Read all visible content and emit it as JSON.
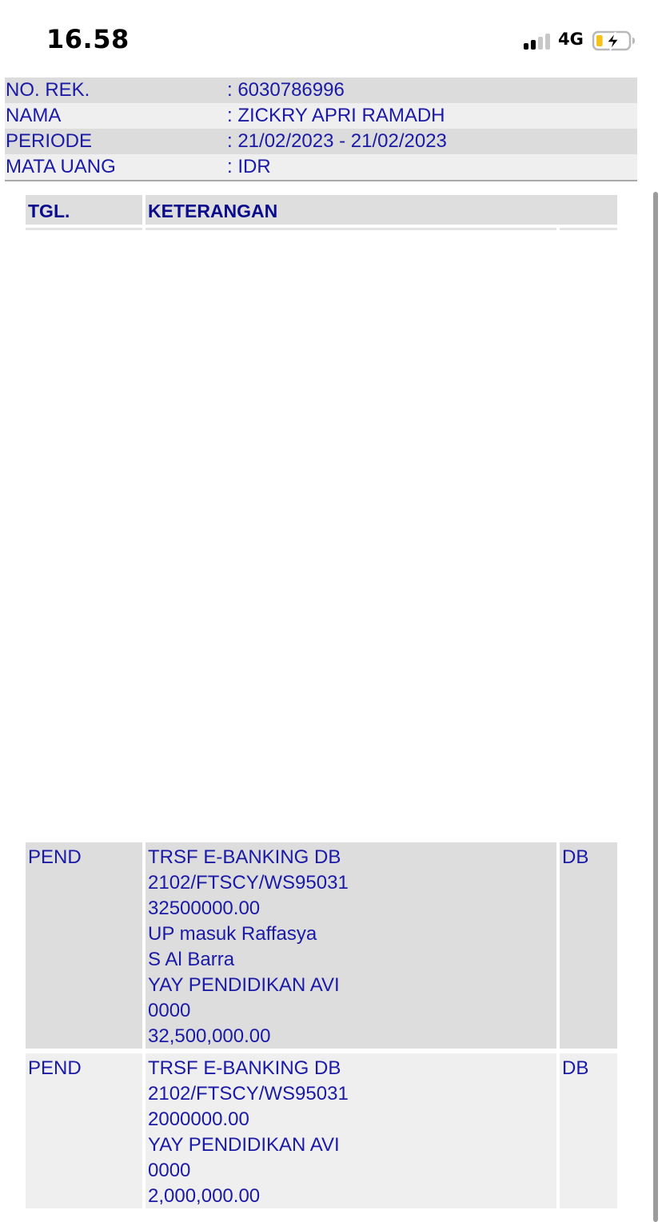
{
  "status_bar": {
    "time": "16.58",
    "network": "4G",
    "icons": [
      "signal-bars-icon",
      "battery-charging-icon"
    ],
    "battery_fill_fraction": 0.2,
    "battery_fill_color": "#f6c21a"
  },
  "account": {
    "rows": [
      {
        "label": "NO. REK.",
        "value": ": 6030786996"
      },
      {
        "label": "NAMA",
        "value": ": ZICKRY APRI RAMADH"
      },
      {
        "label": "PERIODE",
        "value": ": 21/02/2023 - 21/02/2023"
      },
      {
        "label": "MATA UANG",
        "value": ": IDR"
      }
    ]
  },
  "table": {
    "headers": {
      "date": "TGL.",
      "description": "KETERANGAN",
      "type": ""
    },
    "rows": [
      {
        "date": "PEND",
        "description": [
          "TRSF E-BANKING DB",
          "2102/FTSCY/WS95031",
          "32500000.00",
          "UP masuk Raffasya",
          "S Al Barra",
          "YAY PENDIDIKAN AVI",
          "0000",
          "32,500,000.00"
        ],
        "type": "DB"
      },
      {
        "date": "PEND",
        "description": [
          "TRSF E-BANKING DB",
          "2102/FTSCY/WS95031",
          "2000000.00",
          "YAY PENDIDIKAN AVI",
          "0000",
          "2,000,000.00"
        ],
        "type": "DB"
      }
    ]
  },
  "colors": {
    "text_blue": "#1a1aa6",
    "header_blue": "#0a0a8c",
    "row_dark": "#dddddd",
    "row_light": "#efefef"
  }
}
